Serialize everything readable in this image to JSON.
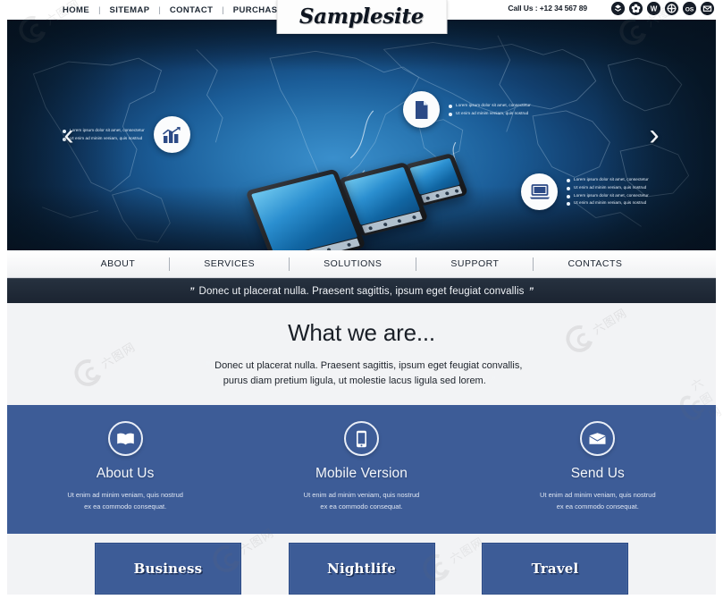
{
  "topbar": {
    "nav": [
      {
        "label": "HOME"
      },
      {
        "label": "SITEMAP"
      },
      {
        "label": "CONTACT"
      },
      {
        "label": "PURCHASE"
      }
    ],
    "separator": "|",
    "call_us": "Call Us : +12 34 567 89",
    "socials": [
      {
        "name": "dropbox-icon",
        "glyph": "☁"
      },
      {
        "name": "flower-icon",
        "glyph": "✿"
      },
      {
        "name": "wordpress-icon",
        "glyph": "W"
      },
      {
        "name": "target-icon",
        "glyph": "⊕"
      },
      {
        "name": "os-icon",
        "glyph": "OS"
      },
      {
        "name": "email-icon",
        "glyph": "✉"
      }
    ]
  },
  "logo": {
    "text": "Samplesite"
  },
  "hero": {
    "prev_arrow": "‹",
    "next_arrow": "›",
    "callouts": [
      {
        "id": "chart",
        "icon": "bar-chart-icon",
        "side": "left",
        "bullets": [
          "Lorem ipsum dolor sit amet, consectetur",
          "Ut enim ad minim veniam, quis nostrud"
        ]
      },
      {
        "id": "document",
        "icon": "document-icon",
        "side": "right",
        "bullets": [
          "Lorem ipsum dolor sit amet, consectetur",
          "Ut enim ad minim veniam, quis nostrud"
        ]
      },
      {
        "id": "laptop",
        "icon": "laptop-icon",
        "side": "right",
        "bullets": [
          "Lorem ipsum dolor sit amet, consectetur",
          "Ut enim ad minim veniam, quis nostrud",
          "Lorem ipsum dolor sit amet, consectetur",
          "Ut enim ad minim veniam, quis nostrud"
        ]
      }
    ]
  },
  "subnav": {
    "items": [
      {
        "label": "ABOUT"
      },
      {
        "label": "SERVICES"
      },
      {
        "label": "SOLUTIONS"
      },
      {
        "label": "SUPPORT"
      },
      {
        "label": "CONTACTS"
      }
    ]
  },
  "quotebar": {
    "open_mark": "”",
    "text": "Donec ut placerat nulla. Praesent sagittis, ipsum eget feugiat convallis",
    "close_mark": "”"
  },
  "whatwe": {
    "heading": "What we are...",
    "open_mark": "”",
    "line1": "Donec ut placerat nulla. Praesent sagittis, ipsum eget feugiat convallis,",
    "line2": "purus diam pretium ligula, ut molestie lacus ligula sed lorem.",
    "close_mark": "”"
  },
  "features": [
    {
      "icon": "book-icon",
      "title": "About Us",
      "line1": "Ut enim ad minim veniam, quis nostrud",
      "line2": "ex ea commodo consequat."
    },
    {
      "icon": "mobile-phone-icon",
      "title": "Mobile Version",
      "line1": "Ut enim ad minim veniam, quis nostrud",
      "line2": "ex ea commodo consequat."
    },
    {
      "icon": "envelope-icon",
      "title": "Send Us",
      "line1": "Ut enim ad minim veniam, quis nostrud",
      "line2": "ex ea commodo consequat."
    }
  ],
  "cards": [
    {
      "label": "Business"
    },
    {
      "label": "Nightlife"
    },
    {
      "label": "Travel"
    }
  ],
  "watermark": {
    "text": "六图网"
  },
  "colors": {
    "accent_blue": "#3d5c97",
    "dark_navy": "#1b2431",
    "light_grey": "#f2f3f5",
    "hero_blue": "#2a78b4",
    "white": "#ffffff"
  }
}
